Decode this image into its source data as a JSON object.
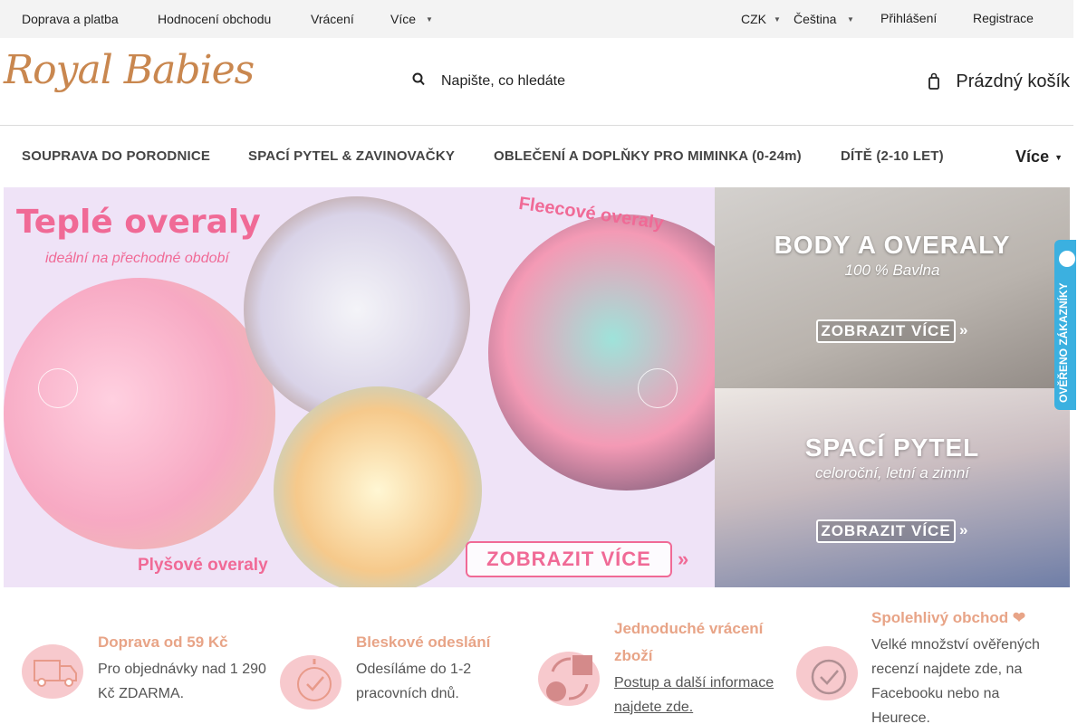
{
  "topbar": {
    "shipping": "Doprava a platba",
    "rating": "Hodnocení obchodu",
    "returns": "Vrácení",
    "more": "Více",
    "currency": "CZK",
    "language": "Čeština",
    "login": "Přihlášení",
    "register": "Registrace"
  },
  "header": {
    "logo": "Royal Babies",
    "search_placeholder": "Napište, co hledáte",
    "cart": "Prázdný košík"
  },
  "nav": {
    "items": [
      "SOUPRAVA DO PORODNICE",
      "SPACÍ PYTEL & ZAVINOVAČKY",
      "OBLEČENÍ A DOPLŇKY PRO MIMINKA (0-24m)",
      "DÍTĚ (2-10 LET)"
    ],
    "more": "Více"
  },
  "hero": {
    "title": "Teplé overaly",
    "subtitle": "ideální na přechodné období",
    "fleece": "Fleecové overaly",
    "plush": "Plyšové overaly",
    "cta": "ZOBRAZIT VÍCE"
  },
  "side_banners": [
    {
      "title": "BODY A OVERALY",
      "subtitle": "100 % Bavlna",
      "cta": "ZOBRAZIT VÍCE"
    },
    {
      "title": "SPACÍ PYTEL",
      "subtitle": "celoroční, letní a zimní",
      "cta": "ZOBRAZIT VÍCE"
    }
  ],
  "verified_tab": "OVĚŘENO ZÁKAZNÍKY",
  "benefits": [
    {
      "title": "Doprava od 59 Kč",
      "body": [
        "Pro objednávky nad 1 290",
        "Kč ZDARMA."
      ],
      "icon": "truck-icon"
    },
    {
      "title": "Bleskové odeslání",
      "body": [
        "Odesíláme do 1-2",
        "pracovních dnů."
      ],
      "icon": "stopwatch-icon"
    },
    {
      "title": [
        "Jednoduché vrácení",
        "zboží"
      ],
      "body": [
        "Postup a další informace",
        "najdete zde."
      ],
      "icon": "return-money-icon"
    },
    {
      "title": "Spolehlivý obchod ❤",
      "body": [
        "Velké množství ověřených",
        "recenzí najdete zde, na",
        "Facebooku nebo na",
        "Heurece."
      ],
      "icon": "checkmark-icon"
    }
  ],
  "colors": {
    "accent": "#e8a487",
    "pink": "#f06a96",
    "logo": "#c9874f"
  }
}
